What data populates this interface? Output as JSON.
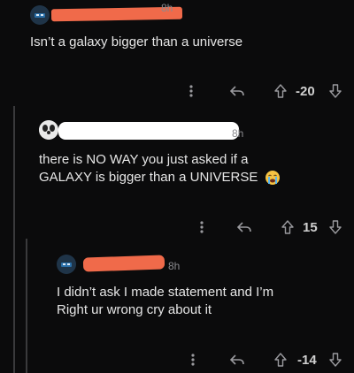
{
  "colors": {
    "background": "#0b0b0c",
    "redaction_orange": "#f06a4a",
    "redaction_white": "#ffffff",
    "text": "#e6e6e6",
    "muted": "#8a8a8e"
  },
  "comments": [
    {
      "time": "8h",
      "text_lines": [
        "Isn’t a galaxy bigger than a universe"
      ],
      "score": "-20",
      "icons": [
        "more-icon",
        "reply-icon",
        "upvote-icon",
        "downvote-icon"
      ]
    },
    {
      "time": "8h",
      "text_lines": [
        "there is NO WAY you just asked if a",
        "GALAXY is bigger than a UNIVERSE"
      ],
      "emoji": "😭",
      "score": "15",
      "icons": [
        "more-icon",
        "reply-icon",
        "upvote-icon",
        "downvote-icon"
      ]
    },
    {
      "time": "8h",
      "text_lines": [
        "I didn’t ask I made statement and I’m",
        "Right ur wrong cry about it"
      ],
      "score": "-14",
      "icons": [
        "more-icon",
        "reply-icon",
        "upvote-icon",
        "downvote-icon"
      ]
    }
  ]
}
